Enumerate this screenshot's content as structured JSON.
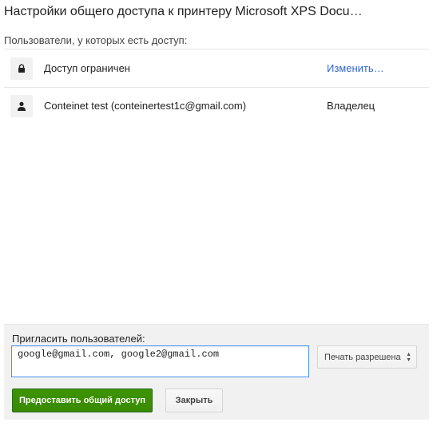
{
  "dialog": {
    "title": "Настройки общего доступа к принтеру Microsoft XPS Docu…",
    "access_label": "Пользователи, у которых есть доступ:"
  },
  "users": [
    {
      "icon": "lock-icon",
      "name": "Доступ ограничен",
      "action": "Изменить…",
      "action_is_link": true
    },
    {
      "icon": "person-icon",
      "name": "Conteinet test (conteinertest1c@gmail.com)",
      "action": "Владелец",
      "action_is_link": false
    }
  ],
  "invite": {
    "label": "Пригласить пользователей:",
    "input_value": "google@gmail.com, google2@gmail.com",
    "permission": "Печать разрешена",
    "share_label": "Предоставить общий доступ",
    "close_label": "Закрыть"
  },
  "colors": {
    "accent_link": "#3366cc",
    "share_button": "#3d9400",
    "input_focus": "#4d90fe"
  }
}
